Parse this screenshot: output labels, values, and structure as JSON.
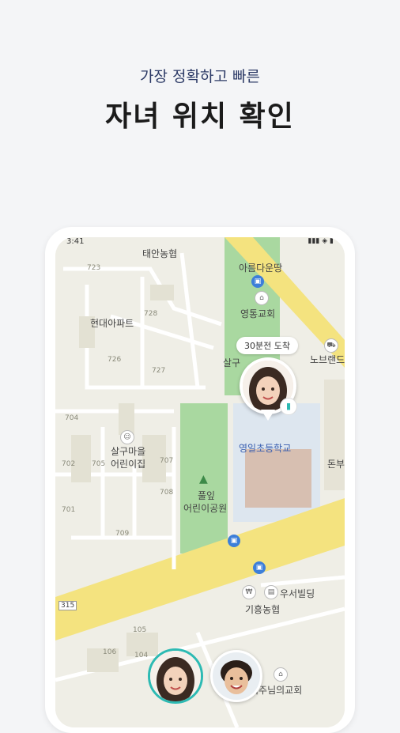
{
  "header": {
    "subtitle": "가장 정확하고 빠른",
    "title": "자녀 위치 확인"
  },
  "status_bar": {
    "time": "3:41",
    "icons": "▮▮▮ ◈ ▮"
  },
  "map": {
    "places": [
      {
        "id": "taean",
        "label": "태안농협"
      },
      {
        "id": "areumdaun",
        "label": "아름다운땅"
      },
      {
        "id": "church",
        "label": "영통교회"
      },
      {
        "id": "apt",
        "label": "현대아파트"
      },
      {
        "id": "nobrand",
        "label": "노브랜드"
      },
      {
        "id": "salgu",
        "label": "살구"
      },
      {
        "id": "school",
        "label": "영일초등학교"
      },
      {
        "id": "kinder1",
        "label": "살구마을"
      },
      {
        "id": "kinder2",
        "label": "어린이집"
      },
      {
        "id": "park1",
        "label": "풀잎"
      },
      {
        "id": "park2",
        "label": "어린이공원"
      },
      {
        "id": "donbu",
        "label": "돈부"
      },
      {
        "id": "woose",
        "label": "우서빌딩"
      },
      {
        "id": "giheung",
        "label": "기흥농협"
      },
      {
        "id": "church2",
        "label": "녀주님의교회"
      },
      {
        "id": "road",
        "label": "315"
      }
    ],
    "block_numbers": [
      "723",
      "728",
      "726",
      "727",
      "704",
      "705",
      "707",
      "708",
      "709",
      "105",
      "106",
      "104",
      "702",
      "701"
    ],
    "arrival_bubble": "30분전 도착",
    "battery_icon": "battery-icon"
  },
  "colors": {
    "title": "#1b1b1b",
    "subtitle": "#2c3a66",
    "park": "#8fcf8a",
    "road_main": "#f4e37f",
    "accent_teal": "#2dbab3",
    "bus_blue": "#3d7fd9"
  }
}
